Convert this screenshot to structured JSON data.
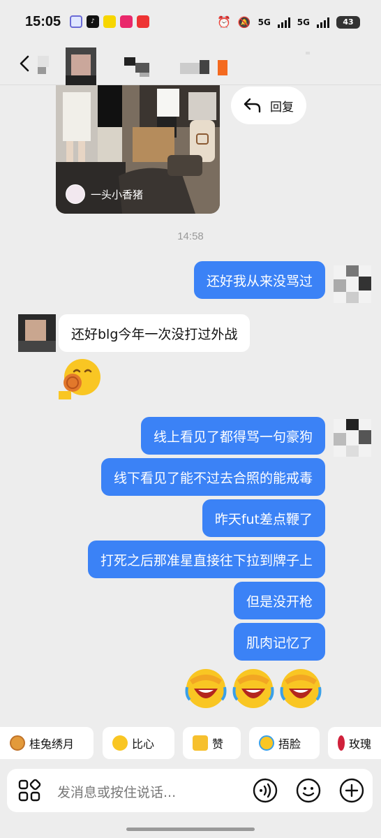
{
  "status_bar": {
    "time": "15:05",
    "network_1": "5G",
    "network_2": "5G",
    "battery": "43"
  },
  "shared_post": {
    "author": "一头小香猪",
    "reply_label": "回复"
  },
  "timestamp": "14:58",
  "messages": [
    {
      "from": "me",
      "text": "还好我从来没骂过"
    },
    {
      "from": "them",
      "text": "还好blg今年一次没打过外战"
    },
    {
      "from": "them",
      "emoji": "mooncake-eating-emoji"
    },
    {
      "from": "me",
      "text": "线上看见了都得骂一句豪狗"
    },
    {
      "from": "me",
      "text": "线下看见了能不过去合照的能戒毒"
    },
    {
      "from": "me",
      "text": "昨天fut差点鞭了"
    },
    {
      "from": "me",
      "text": "打死之后那准星直接往下拉到牌子上"
    },
    {
      "from": "me",
      "text": "但是没开枪"
    },
    {
      "from": "me",
      "text": "肌肉记忆了"
    },
    {
      "from": "me",
      "emoji": "facepalm-laugh-emoji-x3"
    }
  ],
  "quick_replies": [
    {
      "label": "桂兔绣月",
      "icon": "mooncake-icon"
    },
    {
      "label": "比心",
      "icon": "heart-hands-icon"
    },
    {
      "label": "赞",
      "icon": "thumbs-up-icon"
    },
    {
      "label": "捂脸",
      "icon": "facepalm-icon"
    },
    {
      "label": "玫瑰",
      "icon": "rose-icon"
    }
  ],
  "input": {
    "placeholder": "发消息或按住说话..."
  },
  "colors": {
    "background": "#ededed",
    "my_bubble": "#3b82f6",
    "their_bubble": "#ffffff"
  }
}
